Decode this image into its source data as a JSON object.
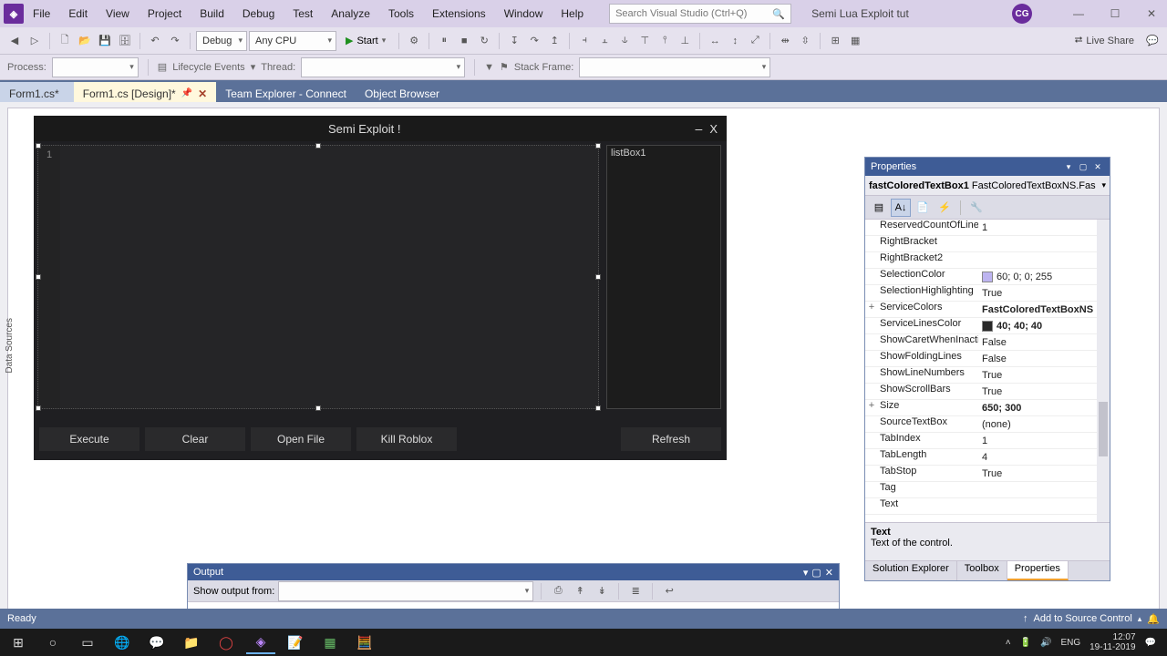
{
  "menu": [
    "File",
    "Edit",
    "View",
    "Project",
    "Build",
    "Debug",
    "Test",
    "Analyze",
    "Tools",
    "Extensions",
    "Window",
    "Help"
  ],
  "search_placeholder": "Search Visual Studio (Ctrl+Q)",
  "project_name": "Semi Lua Exploit tut",
  "avatar_initials": "CG",
  "toolbar": {
    "config": "Debug",
    "platform": "Any CPU",
    "start": "Start",
    "live_share": "Live Share"
  },
  "toolbar2": {
    "process": "Process:",
    "lifecycle": "Lifecycle Events",
    "thread": "Thread:",
    "stackframe": "Stack Frame:"
  },
  "side_strip": "Data Sources",
  "tabs": [
    {
      "label": "Form1.cs*",
      "kind": "unmodified"
    },
    {
      "label": "Form1.cs [Design]*",
      "kind": "active"
    },
    {
      "label": "Team Explorer - Connect",
      "kind": "plain"
    },
    {
      "label": "Object Browser",
      "kind": "plain"
    }
  ],
  "form": {
    "title": "Semi Exploit !",
    "line1": "1",
    "listbox": "listBox1",
    "buttons": [
      "Execute",
      "Clear",
      "Open File",
      "Kill Roblox"
    ],
    "refresh": "Refresh"
  },
  "props": {
    "title": "Properties",
    "obj_name": "fastColoredTextBox1",
    "obj_type": "FastColoredTextBoxNS.Fas",
    "rows": [
      {
        "name": "ReservedCountOfLine",
        "value": "1"
      },
      {
        "name": "RightBracket",
        "value": ""
      },
      {
        "name": "RightBracket2",
        "value": ""
      },
      {
        "name": "SelectionColor",
        "value": "60; 0; 0; 255",
        "swatch": "#bdb4f0"
      },
      {
        "name": "SelectionHighlighting",
        "value": "True"
      },
      {
        "name": "ServiceColors",
        "value": "FastColoredTextBoxNS",
        "bold": true,
        "expand": "+"
      },
      {
        "name": "ServiceLinesColor",
        "value": "40; 40; 40",
        "swatch": "#282828",
        "bold": true
      },
      {
        "name": "ShowCaretWhenInacti",
        "value": "False"
      },
      {
        "name": "ShowFoldingLines",
        "value": "False"
      },
      {
        "name": "ShowLineNumbers",
        "value": "True"
      },
      {
        "name": "ShowScrollBars",
        "value": "True"
      },
      {
        "name": "Size",
        "value": "650; 300",
        "bold": true,
        "expand": "+"
      },
      {
        "name": "SourceTextBox",
        "value": "(none)"
      },
      {
        "name": "TabIndex",
        "value": "1"
      },
      {
        "name": "TabLength",
        "value": "4"
      },
      {
        "name": "TabStop",
        "value": "True"
      },
      {
        "name": "Tag",
        "value": ""
      },
      {
        "name": "Text",
        "value": ""
      }
    ],
    "desc_name": "Text",
    "desc_text": "Text of the control.",
    "bottom_tabs": [
      "Solution Explorer",
      "Toolbox",
      "Properties"
    ]
  },
  "output": {
    "title": "Output",
    "show_from": "Show output from:"
  },
  "status": {
    "ready": "Ready",
    "add_src": "Add to Source Control"
  },
  "tray": {
    "lang": "ENG",
    "time": "12:07",
    "date": "19-11-2019"
  }
}
